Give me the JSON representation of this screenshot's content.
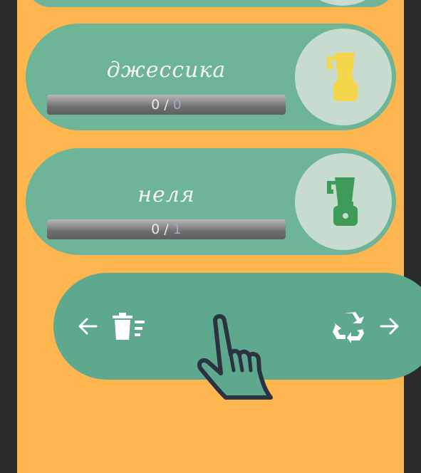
{
  "rows": [
    {
      "name": "джессика",
      "done": "0",
      "sep": " / ",
      "total": "0",
      "icon": "blender-icon",
      "icon_color": "#f4d64a"
    },
    {
      "name": "неля",
      "done": "0",
      "sep": " / ",
      "total": "1",
      "icon": "blender-icon",
      "icon_color": "#3f9c58"
    }
  ],
  "actions": {
    "left_arrow": "arrow-left-icon",
    "delete": "delete-list-icon",
    "recycle": "recycle-icon",
    "right_arrow": "arrow-right-icon"
  },
  "colors": {
    "background": "#fdb64f",
    "card": "#6db596",
    "actions": "#5ea98e",
    "circle": "#c7dccf"
  }
}
